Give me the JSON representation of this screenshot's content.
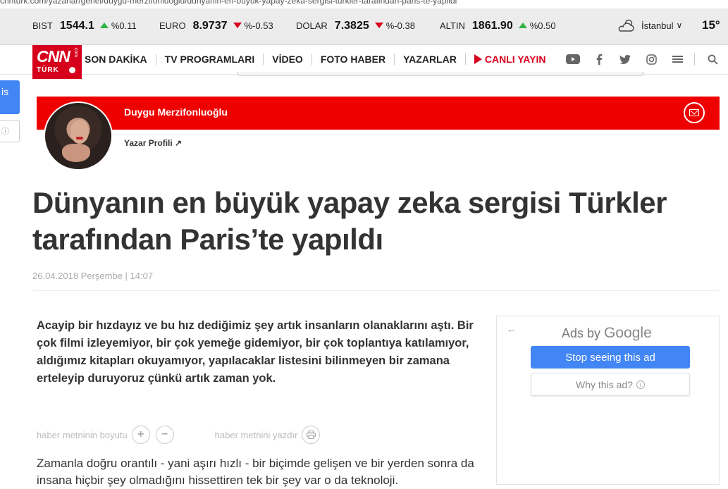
{
  "browser": {
    "url_text": "cnnturk.com/yazarlar/genel/duygu-merzifonluoglu/dunyanin-en-buyuk-yapay-zeka-sergisi-turkler-tarafindan-paris-te-yapildi"
  },
  "ticker": {
    "items": [
      {
        "name": "BIST",
        "value": "1544.1",
        "direction": "up",
        "change": "%0.11"
      },
      {
        "name": "EURO",
        "value": "8.9737",
        "direction": "down",
        "change": "%-0.53"
      },
      {
        "name": "DOLAR",
        "value": "7.3825",
        "direction": "down",
        "change": "%-0.38"
      },
      {
        "name": "ALTIN",
        "value": "1861.90",
        "direction": "up",
        "change": "%0.50"
      }
    ],
    "city": "İstanbul",
    "temperature": "15°"
  },
  "nav": {
    "logo_text": "CNN",
    "logo_sub": "TÜRK",
    "logo_com": ".com",
    "items": [
      "SON DAKİKA",
      "TV PROGRAMLARI",
      "VİDEO",
      "FOTO HABER",
      "YAZARLAR"
    ],
    "live_label": "CANLI YAYIN",
    "icons": [
      "youtube-icon",
      "facebook-icon",
      "twitter-icon",
      "instagram-icon",
      "menu-icon",
      "search-icon"
    ]
  },
  "left_fragments": {
    "blue_text": "is",
    "white_text": "ⓘ"
  },
  "author": {
    "name": "Duygu Merzifonluoğlu",
    "profile_link": "Yazar Profili ↗"
  },
  "article": {
    "headline": "Dünyanın en büyük yapay zeka sergisi Türkler tarafından Paris’te yapıldı",
    "date": "26.04.2018 Perşembe | 14:07",
    "lead": "Acayip bir hızdayız ve bu hız dediğimiz şey artık insanların olanaklarını aştı. Bir çok filmi izleyemiyor, bir çok yemeğe gidemiyor, bir çok toplantıya katılamıyor, aldığımız kitapları okuyamıyor, yapılacaklar listesini bilinmeyen bir zamana erteleyip duruyoruz çünkü artık zaman yok.",
    "body": "Zamanla doğru orantılı - yani aşırı hızlı - bir biçimde gelişen ve bir yerden sonra da insana hiçbir şey olmadığını hissettiren tek bir şey var o da teknoloji."
  },
  "tools": {
    "font_size_label": "haber metninin boyutu",
    "increase_symbol": "+",
    "decrease_symbol": "−",
    "print_label": "haber metnini yazdır",
    "print_symbol": "⎙"
  },
  "ad": {
    "back_symbol": "←",
    "ads_by": "Ads by",
    "google": "Google",
    "stop_label": "Stop seeing this ad",
    "why_label": "Why this ad?",
    "info_symbol": "i"
  },
  "colors": {
    "brand_red": "#e00000",
    "up_green": "#2fb344",
    "down_red": "#d6001c",
    "google_blue": "#4285f4"
  }
}
